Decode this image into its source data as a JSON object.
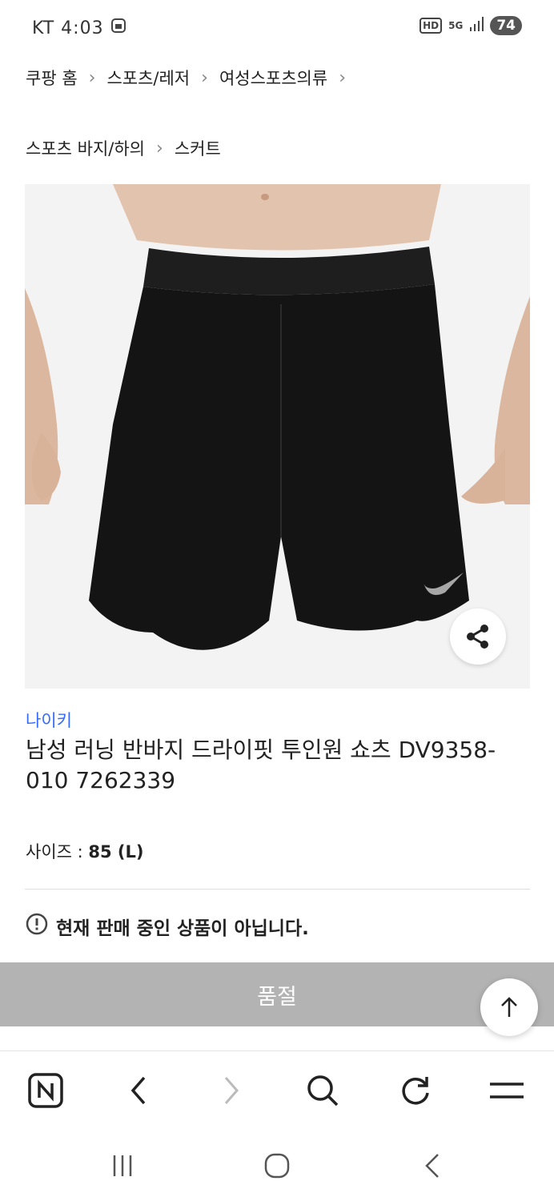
{
  "status_bar": {
    "carrier": "KT",
    "time": "4:03",
    "hd": "HD",
    "network": "5G",
    "battery": "74"
  },
  "breadcrumb_top": [
    "쿠팡 홈",
    "스포츠/레저",
    "여성스포츠의류"
  ],
  "breadcrumb_sub": [
    "스포츠 바지/하의",
    "스커트"
  ],
  "product": {
    "brand": "나이키",
    "title": "남성 러닝 반바지 드라이핏 투인원 쇼츠 DV9358-010 7262339",
    "size_label": "사이즈 : ",
    "size_value": "85 (L)",
    "notice": "현재 판매 중인 상품이 아닙니다.",
    "soldout_label": "품절"
  },
  "colors": {
    "brand_link": "#346aff",
    "soldout_bg": "#b3b3b3"
  }
}
